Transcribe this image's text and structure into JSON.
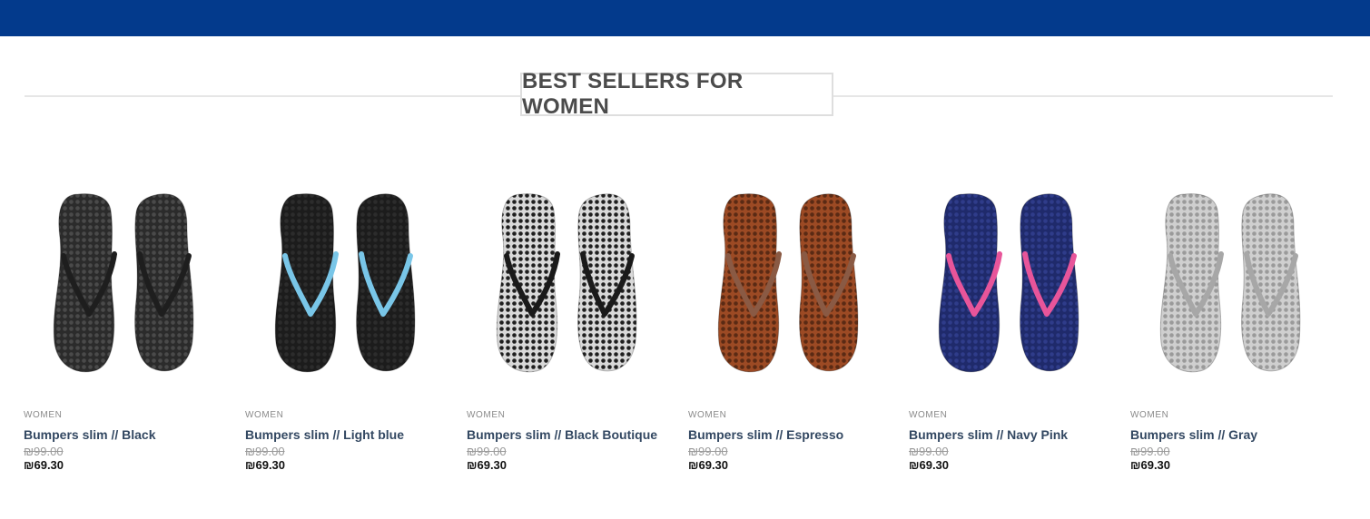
{
  "header": {
    "bar_color": "#033a8c"
  },
  "section": {
    "title": "BEST SELLERS FOR WOMEN"
  },
  "products": [
    {
      "category": "WOMEN",
      "name": "Bumpers slim // Black",
      "old_price": "₪99.00",
      "price": "₪69.30",
      "sole_color": "#2b2b2b",
      "dot_color": "#4a4a4a",
      "strap_color": "#1e1e1e"
    },
    {
      "category": "WOMEN",
      "name": "Bumpers slim // Light blue",
      "old_price": "₪99.00",
      "price": "₪69.30",
      "sole_color": "#1c1c1c",
      "dot_color": "#2c2c2c",
      "strap_color": "#79c6e8"
    },
    {
      "category": "WOMEN",
      "name": "Bumpers slim // Black Boutique",
      "old_price": "₪99.00",
      "price": "₪69.30",
      "sole_color": "#d9d9d9",
      "dot_color": "#1f1f1f",
      "strap_color": "#1a1a1a"
    },
    {
      "category": "WOMEN",
      "name": "Bumpers slim // Espresso",
      "old_price": "₪99.00",
      "price": "₪69.30",
      "sole_color": "#9c4a24",
      "dot_color": "#5a2a14",
      "strap_color": "#8a5a44"
    },
    {
      "category": "WOMEN",
      "name": "Bumpers slim // Navy Pink",
      "old_price": "₪99.00",
      "price": "₪69.30",
      "sole_color": "#1f2a6b",
      "dot_color": "#2f3c8a",
      "strap_color": "#e8559a"
    },
    {
      "category": "WOMEN",
      "name": "Bumpers slim // Gray",
      "old_price": "₪99.00",
      "price": "₪69.30",
      "sole_color": "#cfcfcf",
      "dot_color": "#9a9a9a",
      "strap_color": "#a7a7a7"
    }
  ]
}
